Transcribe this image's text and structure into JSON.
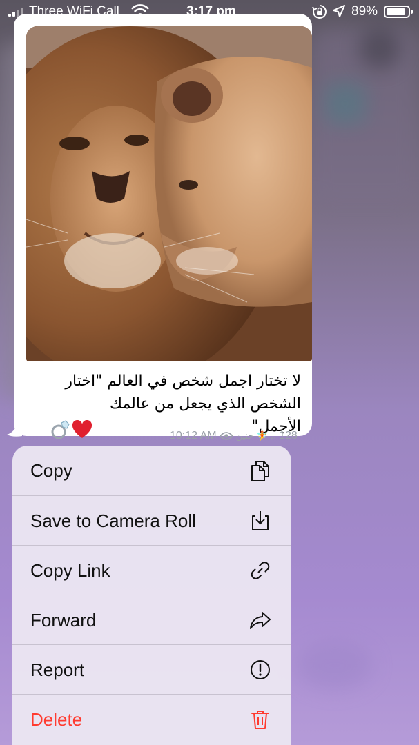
{
  "status_bar": {
    "carrier": "Three WiFi Call",
    "time": "3:17 pm",
    "battery": "89%",
    "battery_level": 0.89
  },
  "message": {
    "text_lines": [
      "لا تختار اجمل شخص في العالم \"اختار",
      "الشخص الذي يجعل من عالمك",
      "الأجمل\""
    ],
    "emojis": "💍❤️",
    "views": "128",
    "author": "حنين 🧚 ,.",
    "timestamp": "10:12 AM"
  },
  "menu": {
    "items": [
      {
        "label": "Copy",
        "icon": "copy-icon"
      },
      {
        "label": "Save to Camera Roll",
        "icon": "save-download-icon"
      },
      {
        "label": "Copy Link",
        "icon": "link-icon"
      },
      {
        "label": "Forward",
        "icon": "forward-icon"
      },
      {
        "label": "Report",
        "icon": "report-exclamation-icon"
      },
      {
        "label": "Delete",
        "icon": "trash-icon"
      }
    ]
  },
  "colors": {
    "delete": "#ff3b30",
    "menu_background": "#ece7f2",
    "background_accent": "#a58ad0"
  }
}
